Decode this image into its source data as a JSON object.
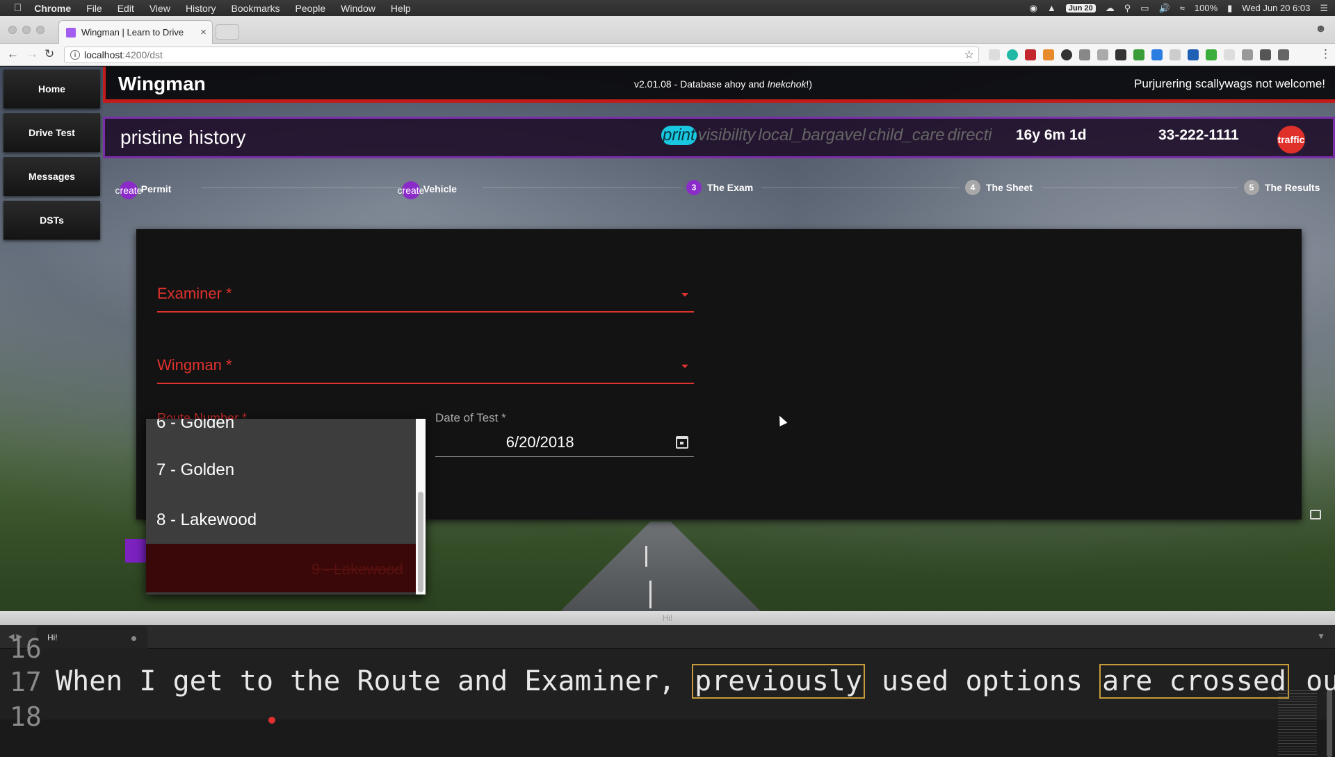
{
  "menubar": {
    "app": "Chrome",
    "items": [
      "File",
      "Edit",
      "View",
      "History",
      "Bookmarks",
      "People",
      "Window",
      "Help"
    ],
    "date_pill": "Jun 20",
    "battery": "100%",
    "clock": "Wed Jun 20  6:03"
  },
  "browser": {
    "tab_title": "Wingman | Learn to Drive",
    "tab_close": "×",
    "url_host": "localhost",
    "url_path": ":4200/dst"
  },
  "sidebar": {
    "items": [
      {
        "label": "Home"
      },
      {
        "label": "Drive Test"
      },
      {
        "label": "Messages"
      },
      {
        "label": "DSTs"
      }
    ]
  },
  "header": {
    "brand": "Wingman",
    "version_prefix": "v2.01.08 - Database ahoy and ",
    "version_italic": "Inekchok",
    "version_suffix": "!)",
    "tagline": "Purjurering scallywags not welcome!"
  },
  "record": {
    "title": "pristine history",
    "chips": [
      "print",
      "visibility",
      "local_bargavel",
      "child_care",
      "directi"
    ],
    "age": "16y 6m 1d",
    "phone": "33-222-1111",
    "badge": "traffic"
  },
  "stepper": {
    "steps": [
      {
        "index": "create",
        "label": "The Permit",
        "state": "done"
      },
      {
        "index": "create",
        "label": "The Vehicle",
        "state": "done"
      },
      {
        "index": "3",
        "label": "The Exam",
        "state": "current"
      },
      {
        "index": "4",
        "label": "The Sheet",
        "state": "todo"
      },
      {
        "index": "5",
        "label": "The Results",
        "state": "todo"
      }
    ]
  },
  "form": {
    "examiner_label": "Examiner *",
    "wingman_label": "Wingman *",
    "route_label": "Route Number *",
    "date_label": "Date of Test *",
    "date_value": "6/20/2018"
  },
  "route_options": {
    "visible": [
      "6 - Golden",
      "7 - Golden",
      "8 - Lakewood"
    ],
    "crossed": "9 - Lakewood"
  },
  "editor": {
    "window_title": "Hi!",
    "tab_label": "Hi!",
    "line_prev": "16",
    "line_cur": "17",
    "line_next": "18",
    "code_part1": "When I get to the Route and Examiner, ",
    "code_hl1": "previously",
    "code_part2": " used options ",
    "code_hl2": "are crossed",
    "code_part3": " out."
  }
}
